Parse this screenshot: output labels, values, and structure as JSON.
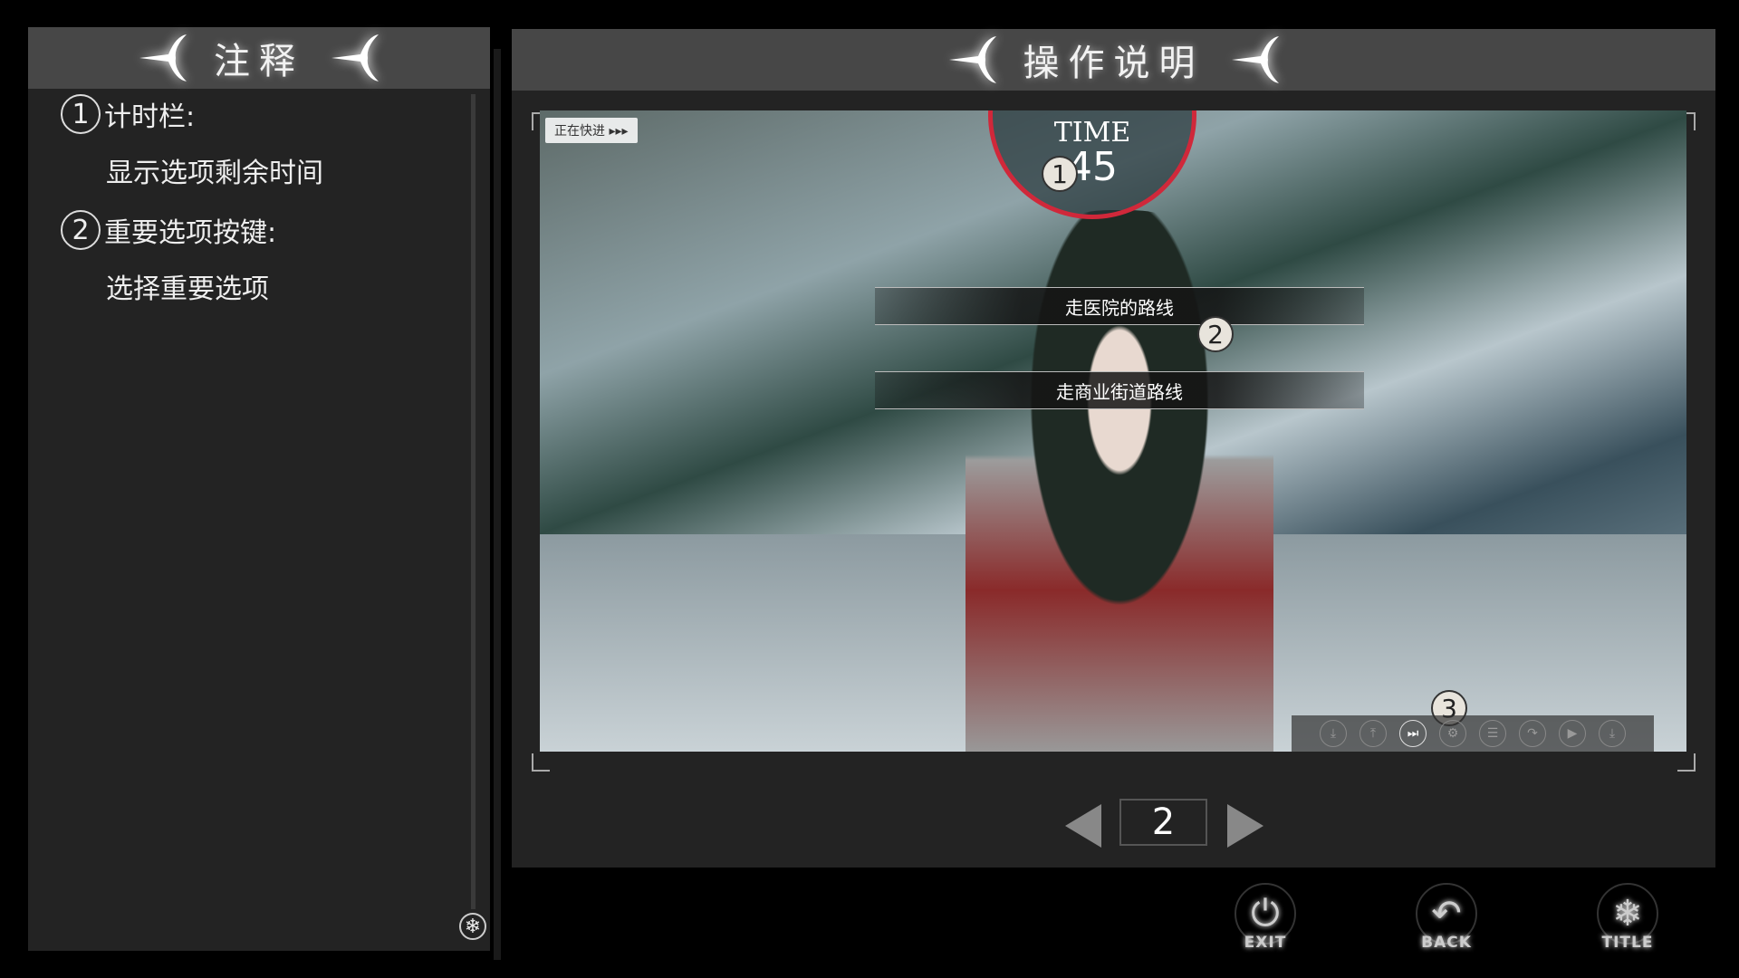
{
  "left_panel": {
    "title": "注释",
    "notes": [
      {
        "num": "1",
        "heading": "计时栏:",
        "desc": "显示选项剩余时间"
      },
      {
        "num": "2",
        "heading": "重要选项按键:",
        "desc": "选择重要选项"
      }
    ],
    "corner_icon": "snowflake-icon"
  },
  "right_panel": {
    "title": "操作说明",
    "screenshot": {
      "fast_forward_label": "正在快进 ▸▸▸",
      "timer_label": "TIME",
      "timer_value": "45",
      "choices": [
        "走医院的路线",
        "走商业街道路线"
      ],
      "markers": [
        "1",
        "2",
        "3"
      ],
      "toolbar_icons": [
        "save-icon",
        "load-icon",
        "fast-forward-icon",
        "settings-icon",
        "log-icon",
        "skip-icon",
        "auto-play-icon",
        "quick-save-icon"
      ],
      "accent_color": "#d0283a"
    },
    "pager": {
      "page": "2"
    }
  },
  "bottom_buttons": [
    {
      "label": "EXIT",
      "icon": "power-icon"
    },
    {
      "label": "BACK",
      "icon": "back-arrow-icon"
    },
    {
      "label": "TITLE",
      "icon": "snowflake-icon"
    }
  ]
}
